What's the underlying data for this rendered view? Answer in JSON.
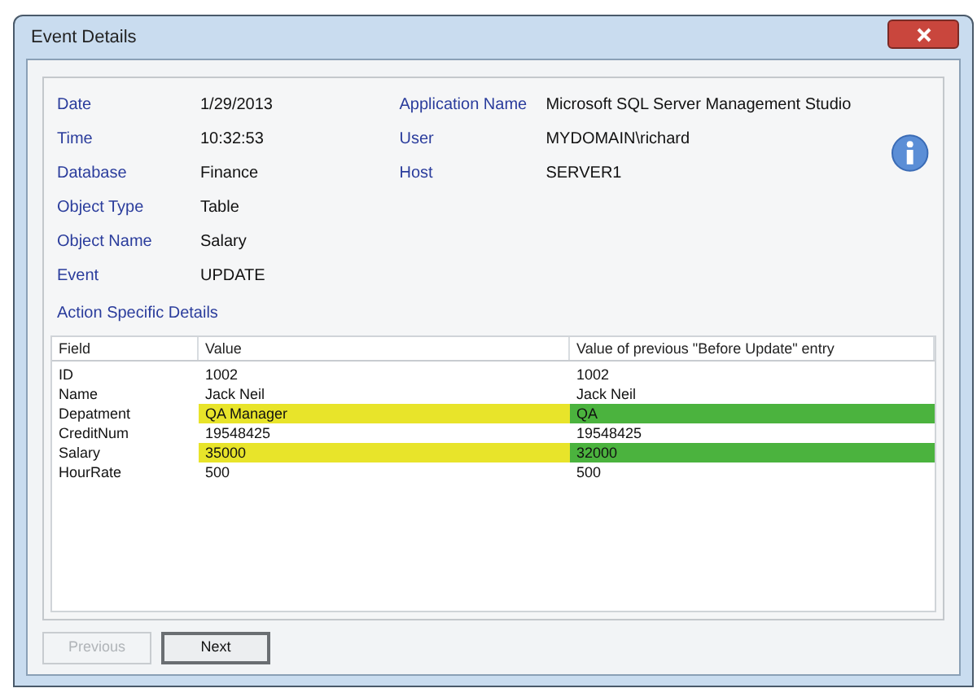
{
  "window": {
    "title": "Event Details"
  },
  "details_left": [
    {
      "label": "Date",
      "value": "1/29/2013"
    },
    {
      "label": "Time",
      "value": "10:32:53"
    },
    {
      "label": "Database",
      "value": "Finance"
    },
    {
      "label": "Object Type",
      "value": "Table"
    },
    {
      "label": "Object Name",
      "value": "Salary"
    },
    {
      "label": "Event",
      "value": "UPDATE"
    }
  ],
  "details_right": [
    {
      "label": "Application Name",
      "value": "Microsoft SQL Server Management Studio"
    },
    {
      "label": "User",
      "value": "MYDOMAIN\\richard"
    },
    {
      "label": "Host",
      "value": "SERVER1"
    }
  ],
  "section_title": "Action Specific Details",
  "table": {
    "columns": [
      "Field",
      "Value",
      "Value of previous \"Before Update\" entry"
    ],
    "rows": [
      {
        "cells": [
          "ID",
          "1002",
          "1002"
        ],
        "changed": false
      },
      {
        "cells": [
          "Name",
          "Jack Neil",
          "Jack Neil"
        ],
        "changed": false
      },
      {
        "cells": [
          "Depatment",
          "QA Manager",
          "QA"
        ],
        "changed": true
      },
      {
        "cells": [
          "CreditNum",
          "19548425",
          "19548425"
        ],
        "changed": false
      },
      {
        "cells": [
          "Salary",
          "35000",
          "32000"
        ],
        "changed": true
      },
      {
        "cells": [
          "HourRate",
          "500",
          "500"
        ],
        "changed": false
      }
    ]
  },
  "buttons": [
    {
      "label": "Previous",
      "disabled": true
    },
    {
      "label": "Next",
      "disabled": false
    }
  ]
}
